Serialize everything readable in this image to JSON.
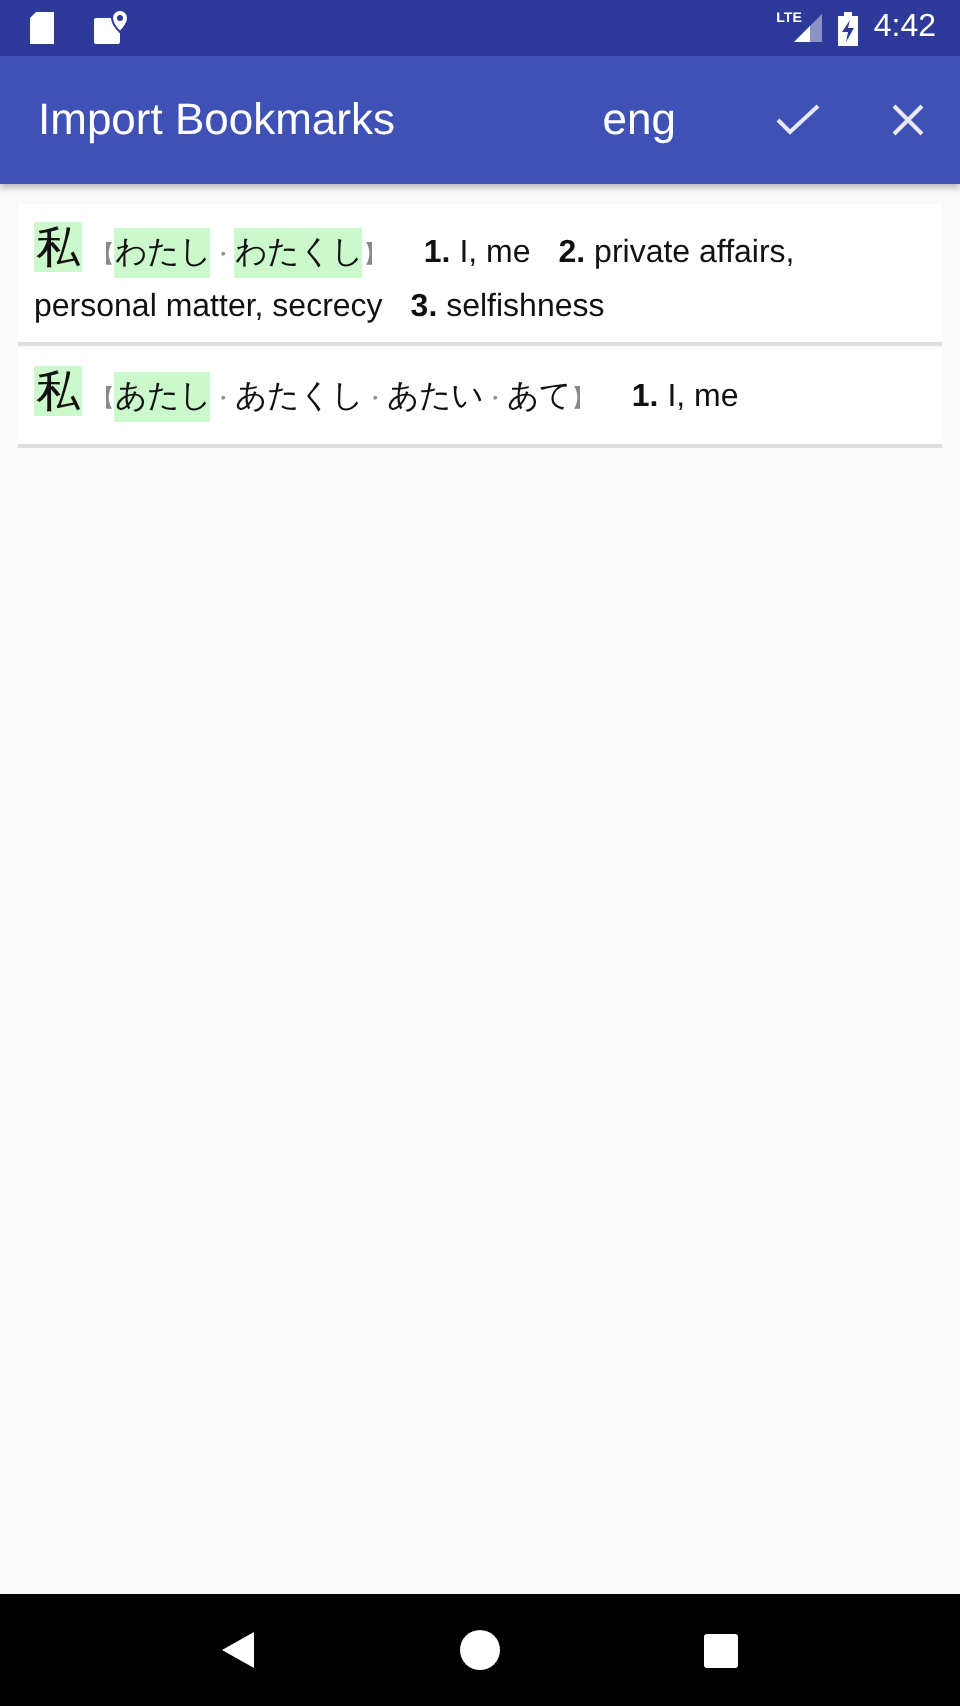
{
  "status_bar": {
    "network": "LTE",
    "time": "4:42"
  },
  "toolbar": {
    "title": "Import Bookmarks",
    "language": "eng"
  },
  "entries": [
    {
      "kanji": {
        "text": "私",
        "highlighted": true
      },
      "open": "【",
      "close": "】",
      "separator": "・",
      "readings": [
        {
          "text": "わたし",
          "highlighted": true
        },
        {
          "text": "わたくし",
          "highlighted": true
        }
      ],
      "senses": [
        {
          "text": "**1.** I, me",
          "new_line": false
        },
        {
          "text": "**2.** private affairs,",
          "new_line": false
        },
        {
          "text": "personal matter, secrecy",
          "new_line": true
        },
        {
          "text": "**3.** selfishness",
          "new_line": false
        }
      ]
    },
    {
      "kanji": {
        "text": "私",
        "highlighted": true
      },
      "open": "【",
      "close": "】",
      "separator": "・",
      "readings": [
        {
          "text": "あたし",
          "highlighted": true
        },
        {
          "text": "あたくし",
          "highlighted": false
        },
        {
          "text": "あたい",
          "highlighted": false
        },
        {
          "text": "あて",
          "highlighted": false
        }
      ],
      "senses": [
        {
          "text": "**1.** I, me",
          "new_line": false
        }
      ]
    }
  ]
}
